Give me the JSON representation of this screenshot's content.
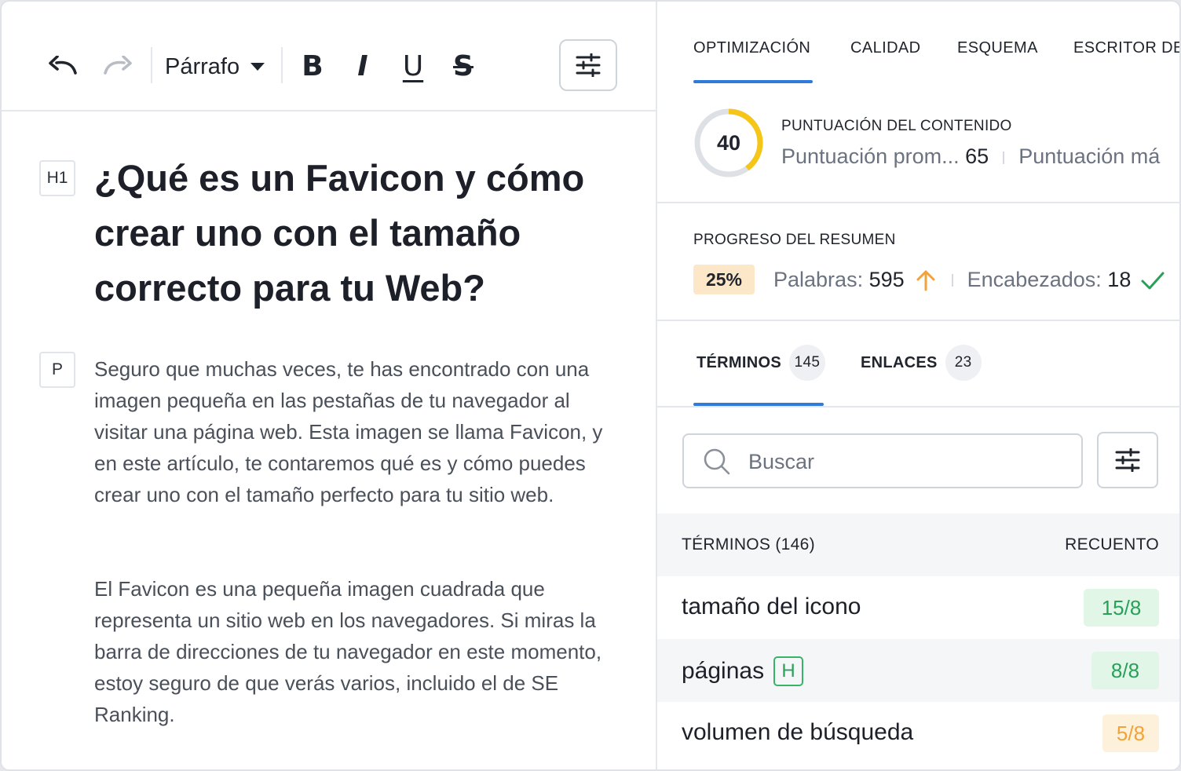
{
  "toolbar": {
    "undo_icon": "undo-icon",
    "redo_icon": "redo-icon",
    "paragraph_select": "Párrafo",
    "bold": "B",
    "italic": "I",
    "underline": "U",
    "strikethrough": "S",
    "settings_icon": "sliders-icon"
  },
  "editor": {
    "h1_tag": "H1",
    "title": "¿Qué es un Favicon y cómo crear uno con el tamaño correcto para tu Web?",
    "p_tag": "P",
    "paragraphs": [
      "Seguro que muchas veces, te has encontrado con una imagen pequeña en las pestañas de tu navegador al visitar una página web. Esta imagen se llama Favicon, y en este artículo, te contaremos qué es y cómo puedes crear uno con el tamaño perfecto para tu sitio web.",
      "El Favicon es una pequeña imagen cuadrada que representa un sitio web en los navegadores. Si miras la barra de direcciones de tu navegador en este momento, estoy seguro de que verás varios, incluido el de SE Ranking."
    ]
  },
  "panel": {
    "tabs": [
      {
        "label": "OPTIMIZACIÓN",
        "active": true
      },
      {
        "label": "CALIDAD"
      },
      {
        "label": "ESQUEMA"
      },
      {
        "label": "ESCRITOR DE I"
      }
    ],
    "score": {
      "value": 40,
      "max": 100,
      "title": "PUNTUACIÓN DEL CONTENIDO",
      "avg_label": "Puntuación prom...",
      "avg_value": "65",
      "max_label": "Puntuación má"
    },
    "progress": {
      "title": "PROGRESO DEL RESUMEN",
      "percent": "25%",
      "words_label": "Palabras:",
      "words_value": "595",
      "headings_label": "Encabezados:",
      "headings_value": "18"
    },
    "subtabs": [
      {
        "label": "TÉRMINOS",
        "count": "145",
        "active": true
      },
      {
        "label": "ENLACES",
        "count": "23"
      }
    ],
    "search": {
      "placeholder": "Buscar"
    },
    "table": {
      "col_terms": "TÉRMINOS (146)",
      "col_count": "RECUENTO",
      "rows": [
        {
          "term": "tamaño del icono",
          "count": "15/8",
          "status": "green"
        },
        {
          "term": "páginas",
          "badge": "H",
          "count": "8/8",
          "status": "green"
        },
        {
          "term": "volumen de búsqueda",
          "count": "5/8",
          "status": "orange"
        }
      ]
    },
    "colors": {
      "accent": "#2f7bdc",
      "score_arc": "#f5c518",
      "ok": "#28a05a",
      "warn": "#f2a23a"
    }
  }
}
